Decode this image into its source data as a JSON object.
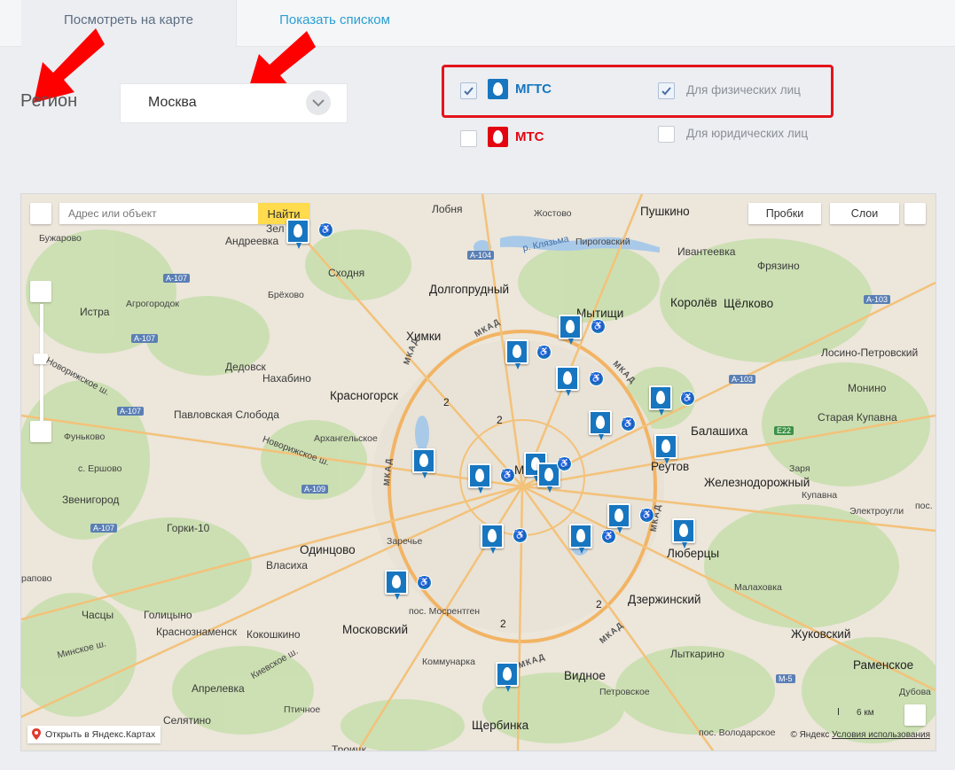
{
  "tabs": {
    "map_view": "Посмотреть на карте",
    "list_view": "Показать списком"
  },
  "filters": {
    "region_label": "Регион",
    "region_value": "Москва",
    "brands": [
      {
        "label": "МГТС",
        "checked": true,
        "color": "#1776bf"
      },
      {
        "label": "МТС",
        "checked": false,
        "color": "#e30611"
      }
    ],
    "client_types": [
      {
        "label": "Для физических лиц",
        "checked": true
      },
      {
        "label": "Для юридических лиц",
        "checked": false
      }
    ],
    "highlight_color": "#e4141b"
  },
  "map": {
    "search_placeholder": "Адрес или объект",
    "search_button": "Найти",
    "traffic_button": "Пробки",
    "layers_button": "Слои",
    "open_yandex": "Открыть в Яндекс.Картах",
    "copyright": "© Яндекс",
    "terms": "Условия использования",
    "scale": "6 км",
    "places": {
      "zelenograd": "Зел",
      "andreevka": "Андреевка",
      "bujarovo": "Бужарово",
      "skhodnya": "Сходня",
      "lobnya": "Лобня",
      "zhostovo": "Жостово",
      "pushkino": "Пушкино",
      "klyazma": "р. Клязьма",
      "pirogovsky": "Пироговский",
      "ivanteevka": "Ивантеевка",
      "fryazino": "Фрязино",
      "dolgoprudny": "Долгопрудный",
      "brekhovo": "Брёхово",
      "istra": "Истра",
      "agrogorodok": "Агрогородок",
      "mytishchi": "Мытищи",
      "korolev": "Королёв",
      "shchelkovo": "Щёлково",
      "khimki": "Химки",
      "dedovsk": "Дедовск",
      "nakhabino": "Нахабино",
      "krasnogorsk": "Красногорск",
      "losino": "Лосино-Петровский",
      "monino": "Монино",
      "pavlovskaya": "Павловская Слобода",
      "staraya_kupavna": "Старая Купавна",
      "balashikha": "Балашиха",
      "arkhangelskoe": "Архангельское",
      "funkovo": "Фуньково",
      "ershovo": "с. Ершово",
      "reutov": "Реутов",
      "zarya": "Заря",
      "zheleznodorozhny": "Железнодорожный",
      "kupavna": "Купавна",
      "zvenigorod": "Звенигород",
      "gorki": "Горки-10",
      "odintsovo": "Одинцово",
      "zarechye": "Заречье",
      "elektrougli": "Электроугли",
      "lyubertsy": "Люберцы",
      "vlasikha": "Власиха",
      "malakhovka": "Малаховка",
      "chastsy": "Часцы",
      "golitsyno": "Голицыно",
      "mosrentgen": "пос. Мосрентген",
      "dzerzhinsky": "Дзержинский",
      "krasnoznamensk": "Краснознаменск",
      "kokoshkino": "Кокошкино",
      "moskovsky": "Московский",
      "zhukovsky": "Жуковский",
      "kommunarka": "Коммунарка",
      "lytkarino": "Лыткарино",
      "ramenskoe": "Раменское",
      "aprelevka": "Апрелевка",
      "vidnoe": "Видное",
      "petrovskoe": "Петровское",
      "dubovaya": "Дубова",
      "selyatino": "Селятино",
      "ptichnoe": "Птичное",
      "shcherbinka": "Щербинка",
      "volodarskoe": "пос. Володарское",
      "moscow": "Мо",
      "pos_im": "пос. им.",
      "rapovo": "рапово",
      "troitsk": "Троицк"
    },
    "roads": {
      "a107": "А-107",
      "a104": "А-104",
      "a103": "А-103",
      "e22": "E22",
      "a109": "А-109",
      "m5": "М-5",
      "mkad": "МКАД",
      "novorizhskoe": "Новорижское ш.",
      "minskoe": "Минское ш.",
      "kievskoe": "Киевское ш."
    },
    "clusters": [
      "2",
      "2",
      "2",
      "2"
    ]
  }
}
